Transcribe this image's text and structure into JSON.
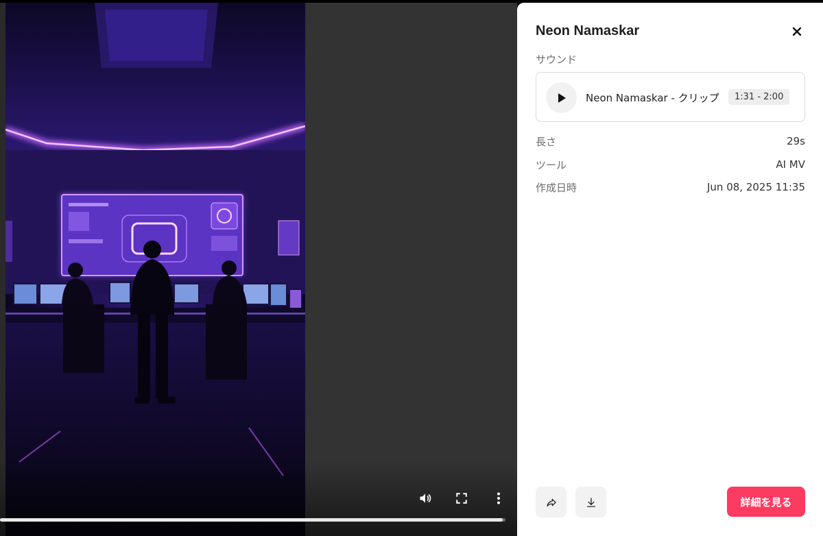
{
  "video": {
    "progress_fraction": 0.995,
    "controls": {
      "volume_icon": "volume-icon",
      "fullscreen_icon": "fullscreen-icon",
      "more_icon": "more-vertical-icon"
    }
  },
  "panel": {
    "title": "Neon Namaskar",
    "close_icon": "close-icon",
    "sound_section_label": "サウンド",
    "sound": {
      "name": "Neon Namaskar - クリップ",
      "range": "1:31 - 2:00",
      "play_icon": "play-icon"
    },
    "details": [
      {
        "key": "長さ",
        "value": "29s"
      },
      {
        "key": "ツール",
        "value": "AI MV"
      },
      {
        "key": "作成日時",
        "value": "Jun 08, 2025 11:35"
      }
    ],
    "actions": {
      "share_icon": "share-icon",
      "download_icon": "download-icon",
      "primary_label": "詳細を見る"
    }
  },
  "colors": {
    "accent": "#fb3b5f",
    "panel_bg": "#ffffff",
    "video_bg": "#333333",
    "neon": "#b04dff"
  }
}
